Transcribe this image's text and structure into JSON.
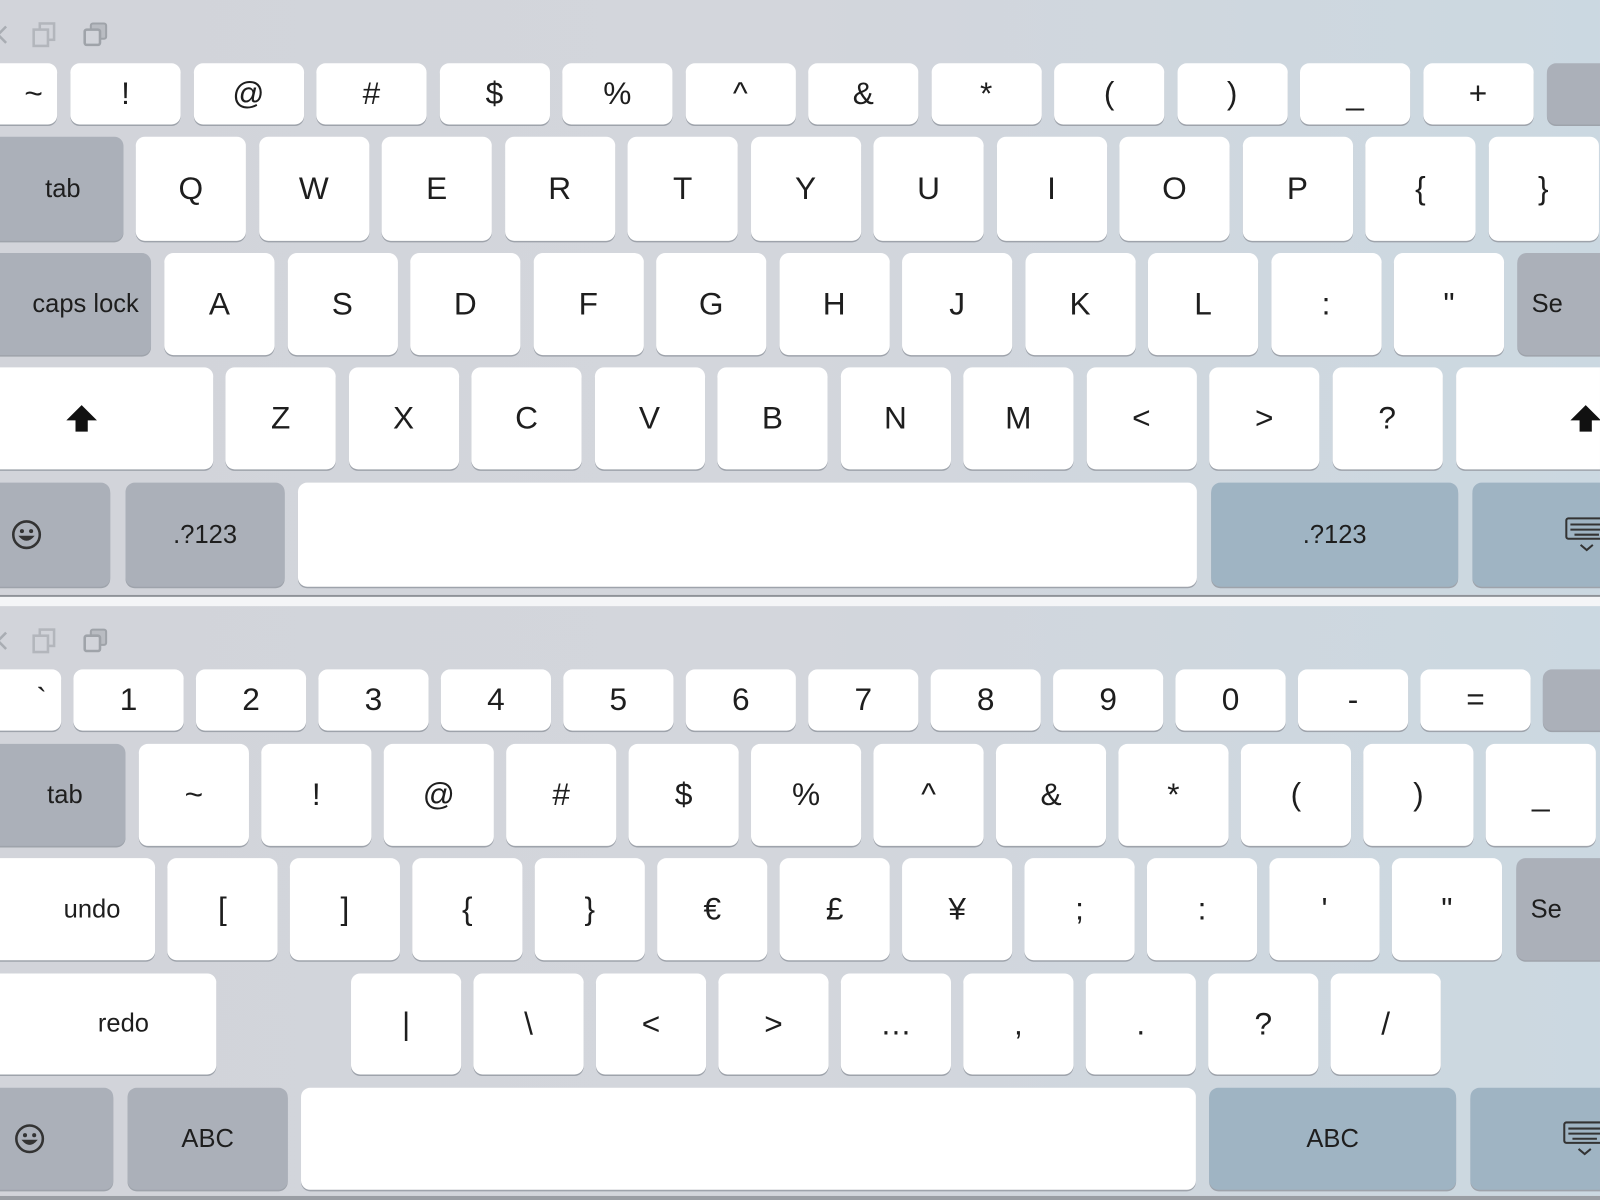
{
  "colors": {
    "key": "#ffffff",
    "function_key": "#abb0b9",
    "accent_key": "#9fb4c3",
    "background": "#d2d4da"
  },
  "toolbar_icons": [
    "back-icon",
    "copy-icon",
    "paste-icon"
  ],
  "keyboards": [
    {
      "name": "letters",
      "rows": [
        {
          "keys": [
            {
              "label": "~",
              "kind": "char"
            },
            {
              "label": "!",
              "kind": "char"
            },
            {
              "label": "@",
              "kind": "char"
            },
            {
              "label": "#",
              "kind": "char"
            },
            {
              "label": "$",
              "kind": "char"
            },
            {
              "label": "%",
              "kind": "char"
            },
            {
              "label": "^",
              "kind": "char"
            },
            {
              "label": "&",
              "kind": "char"
            },
            {
              "label": "*",
              "kind": "char"
            },
            {
              "label": "(",
              "kind": "char"
            },
            {
              "label": ")",
              "kind": "char"
            },
            {
              "label": "_",
              "kind": "char"
            },
            {
              "label": "+",
              "kind": "char"
            },
            {
              "label": "",
              "kind": "func",
              "icon": "delete-icon"
            }
          ]
        },
        {
          "keys": [
            {
              "label": "tab",
              "kind": "func"
            },
            {
              "label": "Q",
              "kind": "char"
            },
            {
              "label": "W",
              "kind": "char"
            },
            {
              "label": "E",
              "kind": "char"
            },
            {
              "label": "R",
              "kind": "char"
            },
            {
              "label": "T",
              "kind": "char"
            },
            {
              "label": "Y",
              "kind": "char"
            },
            {
              "label": "U",
              "kind": "char"
            },
            {
              "label": "I",
              "kind": "char"
            },
            {
              "label": "O",
              "kind": "char"
            },
            {
              "label": "P",
              "kind": "char"
            },
            {
              "label": "{",
              "kind": "char"
            },
            {
              "label": "}",
              "kind": "char"
            }
          ]
        },
        {
          "keys": [
            {
              "label": "caps lock",
              "kind": "func"
            },
            {
              "label": "A",
              "kind": "char"
            },
            {
              "label": "S",
              "kind": "char"
            },
            {
              "label": "D",
              "kind": "char"
            },
            {
              "label": "F",
              "kind": "char"
            },
            {
              "label": "G",
              "kind": "char"
            },
            {
              "label": "H",
              "kind": "char"
            },
            {
              "label": "J",
              "kind": "char"
            },
            {
              "label": "K",
              "kind": "char"
            },
            {
              "label": "L",
              "kind": "char"
            },
            {
              "label": ":",
              "kind": "char"
            },
            {
              "label": "\"",
              "kind": "char"
            },
            {
              "label": "Se",
              "kind": "func"
            }
          ]
        },
        {
          "keys": [
            {
              "label": "",
              "kind": "char",
              "icon": "shift-icon"
            },
            {
              "label": "Z",
              "kind": "char"
            },
            {
              "label": "X",
              "kind": "char"
            },
            {
              "label": "C",
              "kind": "char"
            },
            {
              "label": "V",
              "kind": "char"
            },
            {
              "label": "B",
              "kind": "char"
            },
            {
              "label": "N",
              "kind": "char"
            },
            {
              "label": "M",
              "kind": "char"
            },
            {
              "label": "<",
              "kind": "char"
            },
            {
              "label": ">",
              "kind": "char"
            },
            {
              "label": "?",
              "kind": "char"
            },
            {
              "label": "",
              "kind": "char",
              "icon": "shift-icon"
            }
          ]
        },
        {
          "keys": [
            {
              "label": "",
              "kind": "func",
              "icon": "emoji-icon"
            },
            {
              "label": ".?123",
              "kind": "func"
            },
            {
              "label": "",
              "kind": "char",
              "icon": "space"
            },
            {
              "label": ".?123",
              "kind": "accent"
            },
            {
              "label": "",
              "kind": "accent",
              "icon": "hide-keyboard-icon"
            }
          ]
        }
      ]
    },
    {
      "name": "symbols",
      "rows": [
        {
          "keys": [
            {
              "label": "`",
              "kind": "char"
            },
            {
              "label": "1",
              "kind": "char"
            },
            {
              "label": "2",
              "kind": "char"
            },
            {
              "label": "3",
              "kind": "char"
            },
            {
              "label": "4",
              "kind": "char"
            },
            {
              "label": "5",
              "kind": "char"
            },
            {
              "label": "6",
              "kind": "char"
            },
            {
              "label": "7",
              "kind": "char"
            },
            {
              "label": "8",
              "kind": "char"
            },
            {
              "label": "9",
              "kind": "char"
            },
            {
              "label": "0",
              "kind": "char"
            },
            {
              "label": "-",
              "kind": "char"
            },
            {
              "label": "=",
              "kind": "char"
            },
            {
              "label": "",
              "kind": "func",
              "icon": "delete-icon"
            }
          ]
        },
        {
          "keys": [
            {
              "label": "tab",
              "kind": "func"
            },
            {
              "label": "~",
              "kind": "char"
            },
            {
              "label": "!",
              "kind": "char"
            },
            {
              "label": "@",
              "kind": "char"
            },
            {
              "label": "#",
              "kind": "char"
            },
            {
              "label": "$",
              "kind": "char"
            },
            {
              "label": "%",
              "kind": "char"
            },
            {
              "label": "^",
              "kind": "char"
            },
            {
              "label": "&",
              "kind": "char"
            },
            {
              "label": "*",
              "kind": "char"
            },
            {
              "label": "(",
              "kind": "char"
            },
            {
              "label": ")",
              "kind": "char"
            },
            {
              "label": "_",
              "kind": "char"
            }
          ]
        },
        {
          "keys": [
            {
              "label": "undo",
              "kind": "word"
            },
            {
              "label": "[",
              "kind": "char"
            },
            {
              "label": "]",
              "kind": "char"
            },
            {
              "label": "{",
              "kind": "char"
            },
            {
              "label": "}",
              "kind": "char"
            },
            {
              "label": "€",
              "kind": "char"
            },
            {
              "label": "£",
              "kind": "char"
            },
            {
              "label": "¥",
              "kind": "char"
            },
            {
              "label": ";",
              "kind": "char"
            },
            {
              "label": ":",
              "kind": "char"
            },
            {
              "label": "'",
              "kind": "char"
            },
            {
              "label": "\"",
              "kind": "char"
            },
            {
              "label": "Se",
              "kind": "func"
            }
          ]
        },
        {
          "keys": [
            {
              "label": "redo",
              "kind": "word"
            },
            {
              "label": "|",
              "kind": "char"
            },
            {
              "label": "\\",
              "kind": "char"
            },
            {
              "label": "<",
              "kind": "char"
            },
            {
              "label": ">",
              "kind": "char"
            },
            {
              "label": "…",
              "kind": "char"
            },
            {
              "label": ",",
              "kind": "char"
            },
            {
              "label": ".",
              "kind": "char"
            },
            {
              "label": "?",
              "kind": "char"
            },
            {
              "label": "/",
              "kind": "char"
            }
          ]
        },
        {
          "keys": [
            {
              "label": "",
              "kind": "func",
              "icon": "emoji-icon"
            },
            {
              "label": "ABC",
              "kind": "func"
            },
            {
              "label": "",
              "kind": "char",
              "icon": "space"
            },
            {
              "label": "ABC",
              "kind": "accent"
            },
            {
              "label": "",
              "kind": "accent",
              "icon": "hide-keyboard-icon"
            }
          ]
        }
      ]
    }
  ]
}
